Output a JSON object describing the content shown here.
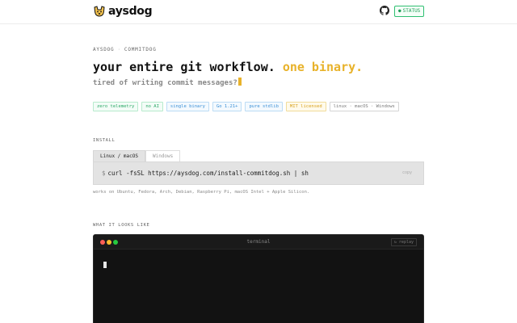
{
  "header": {
    "brand": "aysdog",
    "logo_icon": "dog-face-icon",
    "github_icon": "github-icon",
    "status_label": "STATUS",
    "status_icon": "status-dot-icon"
  },
  "hero": {
    "crumb_parent": "AYSDOG",
    "crumb_separator": "·",
    "crumb_current": "COMMITDOG",
    "headline_main": "your entire git workflow.",
    "headline_accent": "one binary.",
    "subline": "tired of writing commit messages?"
  },
  "tags": [
    {
      "label": "zero telemetry",
      "tone": "green"
    },
    {
      "label": "no AI",
      "tone": "green"
    },
    {
      "label": "single binary",
      "tone": "blue"
    },
    {
      "label": "Go 1.21+",
      "tone": "blue"
    },
    {
      "label": "pure stdlib",
      "tone": "blue"
    },
    {
      "label": "MIT licensed",
      "tone": "yellow"
    },
    {
      "label": "linux · macOS · Windows",
      "tone": "gray"
    }
  ],
  "install": {
    "section_label": "INSTALL",
    "tabs": [
      "Linux / macOS",
      "Windows"
    ],
    "prompt": "$",
    "command": "curl -fsSL https://aysdog.com/install-commitdog.sh | sh",
    "copy_label": "copy",
    "works_on": "works on Ubuntu, Fedora, Arch, Debian, Raspberry Pi, macOS Intel + Apple Silicon."
  },
  "preview": {
    "section_label": "WHAT IT LOOKS LIKE",
    "terminal_title": "terminal",
    "replay_label": "↻ replay"
  },
  "colors": {
    "accent": "#e8b22a",
    "status_green": "#2fbf71",
    "terminal_bg": "#121212"
  }
}
